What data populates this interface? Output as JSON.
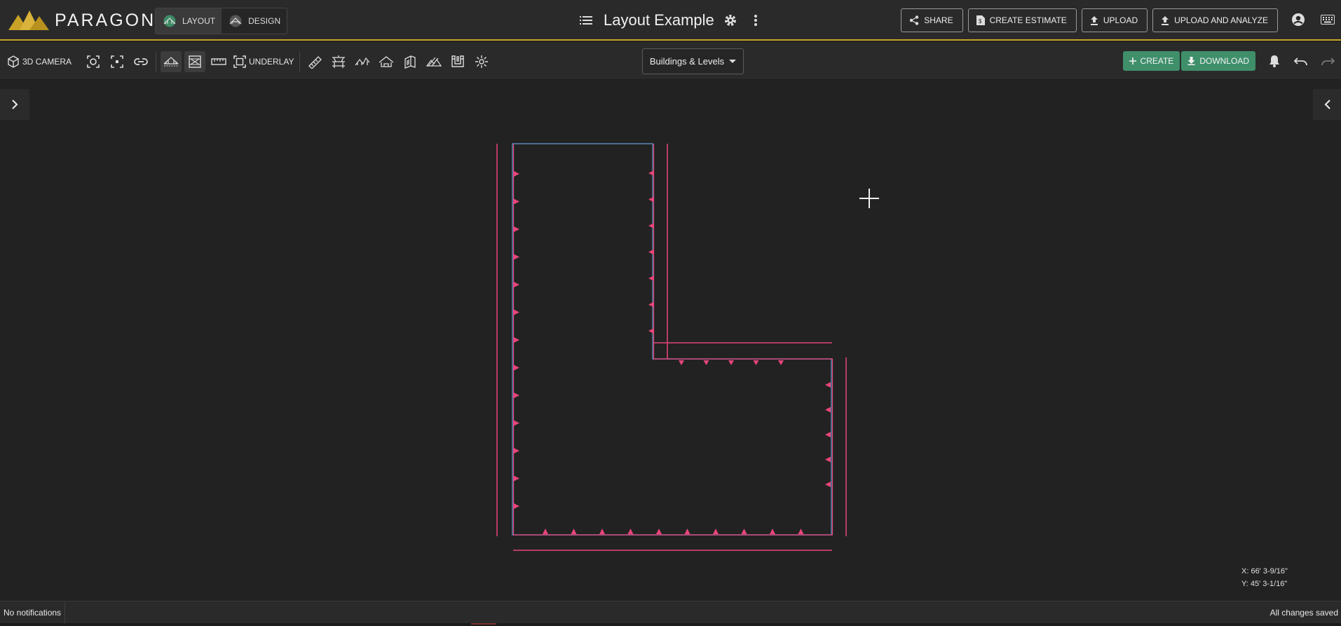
{
  "app": {
    "brand": "PARAGON",
    "brand_colors": {
      "gold": "#c9a227",
      "accent_green": "#3f8f6b",
      "wall_pink": "#e8457a",
      "wall_blue": "#5a8ab8"
    }
  },
  "header": {
    "modes": [
      {
        "label": "LAYOUT",
        "active": true,
        "icon": "layout-truss-icon"
      },
      {
        "label": "DESIGN",
        "active": false,
        "icon": "design-house-icon"
      }
    ],
    "title": "Layout Example",
    "buttons": {
      "share": "SHARE",
      "create_estimate": "CREATE ESTIMATE",
      "upload": "UPLOAD",
      "upload_and_analyze": "UPLOAD AND ANALYZE"
    }
  },
  "toolbar": {
    "camera_label": "3D CAMERA",
    "underlay_label": "UNDERLAY",
    "levels_dropdown": "Buildings & Levels",
    "create_label": "CREATE",
    "download_label": "DOWNLOAD"
  },
  "canvas": {
    "cursor_coords": {
      "x": "X: 66' 3-9/16\"",
      "y": "Y: 45' 3-1/16\""
    }
  },
  "status": {
    "notifications": "No notifications",
    "save_state": "All changes saved"
  }
}
